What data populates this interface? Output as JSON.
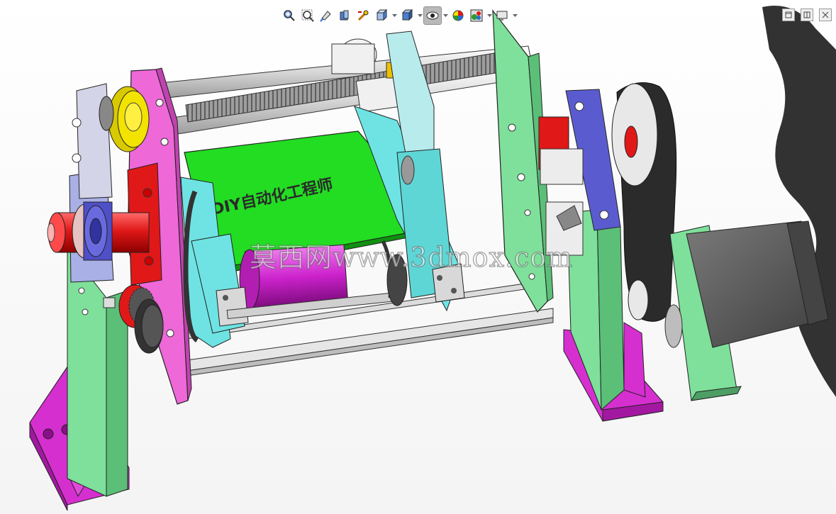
{
  "app": {
    "name": "SolidWorks 3D model viewport"
  },
  "heads_up_toolbar": {
    "tools": [
      {
        "name": "zoom-to-fit-icon",
        "active": false
      },
      {
        "name": "zoom-to-area-icon",
        "active": false
      },
      {
        "name": "previous-view-icon",
        "active": false
      },
      {
        "name": "section-view-icon",
        "active": false
      },
      {
        "name": "dynamic-annotation-icon",
        "active": false
      },
      {
        "name": "view-orientation-icon",
        "active": false,
        "dropdown": true
      },
      {
        "name": "display-style-icon",
        "active": false,
        "dropdown": true
      },
      {
        "name": "hide-show-items-icon",
        "active": true,
        "dropdown": true
      },
      {
        "name": "edit-appearance-icon",
        "active": false
      },
      {
        "name": "apply-scene-icon",
        "active": false,
        "dropdown": true
      },
      {
        "name": "view-settings-icon",
        "active": false,
        "dropdown": true
      }
    ]
  },
  "window_controls": [
    "restore-icon",
    "split-icon",
    "close-icon"
  ],
  "model": {
    "plate_label": "DIY自动化工程师"
  },
  "watermark": {
    "text": "莫西网www.3dmox.com"
  },
  "colors": {
    "frame_pink": "#ee68d8",
    "frame_green": "#7ee09a",
    "base_magenta": "#d62fd0",
    "plate_green": "#22dd22",
    "roller_gray": "#d8d8d8",
    "red_parts": "#e01818",
    "blue_bearing": "#4f4fc8",
    "motor_gray": "#555555",
    "yellow_gear": "#f2e300",
    "cyan_parts": "#6fe3e3"
  }
}
